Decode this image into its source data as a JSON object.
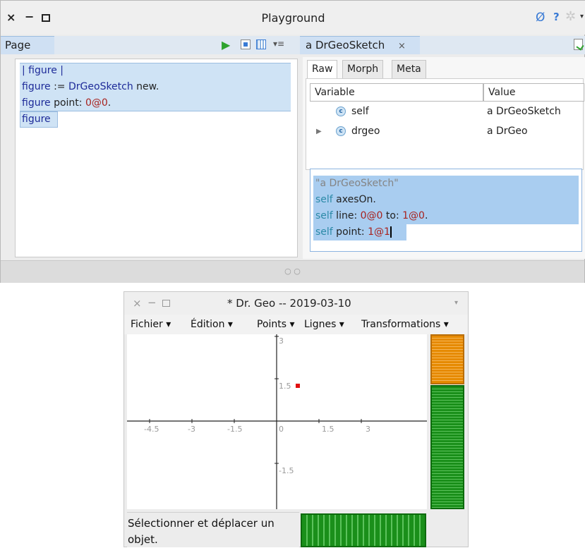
{
  "playground": {
    "title": "Playground",
    "page_tab": "Page",
    "inspector_tab": "a DrGeoSketch",
    "inspector_tab_close": "×",
    "code_lines": [
      [
        "| figure |"
      ],
      [
        "figure := DrGeoSketch new."
      ],
      [
        "figure point: 0@0."
      ],
      [
        "figure"
      ]
    ],
    "subtabs": [
      "Raw",
      "Morph",
      "Meta"
    ],
    "table_headers": {
      "variable": "Variable",
      "value": "Value"
    },
    "rows": [
      {
        "name": "self",
        "value": "a DrGeoSketch",
        "expandable": false
      },
      {
        "name": "drgeo",
        "value": "a DrGeo",
        "expandable": true
      }
    ],
    "eval_code": {
      "comment": "\"a DrGeoSketch\"",
      "line1_recv": "self",
      "line1_msg": " axesOn.",
      "line2_recv": "self",
      "line2_msg": " line: ",
      "line2_a": "0@0",
      "line2_b": " to: ",
      "line2_c": "1@0",
      "line2_end": ".",
      "line3_recv": "self",
      "line3_msg": " point: ",
      "line3_a": "1@1"
    },
    "footer_dots": "○ ○"
  },
  "drgeo": {
    "title": "* Dr. Geo --  2019-03-10",
    "menus": [
      "Fichier ▾",
      "Édition ▾",
      "Points ▾",
      "Lignes ▾",
      "Transformations ▾"
    ],
    "x_ticks": [
      "-4.5",
      "-3",
      "-1.5",
      "0",
      "1.5",
      "3"
    ],
    "y_ticks": [
      "3",
      "1.5",
      "-1.5"
    ],
    "status": "Sélectionner et déplacer un objet.",
    "point": {
      "x": 0.75,
      "y": 1.25,
      "color": "#e01010"
    }
  },
  "colors": {
    "accent": "#1e2b99",
    "orange": "#e68a00",
    "green": "#1a8f1a"
  }
}
